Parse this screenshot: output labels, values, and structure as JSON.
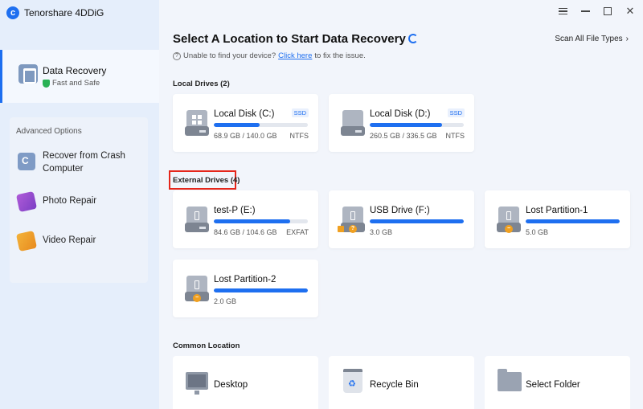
{
  "app": {
    "title": "Tenorshare 4DDiG",
    "logo_letter": "c"
  },
  "sidebar": {
    "data_recovery": {
      "label": "Data Recovery",
      "sub": "Fast and Safe"
    },
    "advanced": {
      "title": "Advanced Options",
      "items": [
        {
          "label": "Recover from Crash Computer",
          "icon": "computer-crash-icon"
        },
        {
          "label": "Photo Repair",
          "icon": "photo-repair-icon"
        },
        {
          "label": "Video Repair",
          "icon": "video-repair-icon"
        }
      ]
    }
  },
  "header": {
    "title": "Select A Location to Start Data Recovery",
    "scan_all": "Scan All File Types",
    "scan_all_arrow": "›",
    "hint_prefix": "Unable to find your device?",
    "hint_link": "Click here",
    "hint_suffix": "to fix the issue."
  },
  "local_drives": {
    "title": "Local Drives (2)",
    "items": [
      {
        "name": "Local Disk (C:)",
        "type": "SSD",
        "size": "68.9 GB / 140.0 GB",
        "fs": "NTFS",
        "used_fraction": 0.49
      },
      {
        "name": "Local Disk (D:)",
        "type": "SSD",
        "size": "260.5 GB / 336.5 GB",
        "fs": "NTFS",
        "used_fraction": 0.77
      }
    ]
  },
  "external_drives": {
    "title": "External Drives (4)",
    "items": [
      {
        "name": "test-P (E:)",
        "size": "84.6 GB / 104.6 GB",
        "fs": "EXFAT",
        "used_fraction": 0.81
      },
      {
        "name": "USB Drive (F:)",
        "size": "3.0 GB",
        "fs": "",
        "used_fraction": 1.0
      },
      {
        "name": "Lost Partition-1",
        "size": "5.0 GB",
        "fs": "",
        "used_fraction": 1.0
      },
      {
        "name": "Lost Partition-2",
        "size": "2.0 GB",
        "fs": "",
        "used_fraction": 1.0
      }
    ]
  },
  "common_location": {
    "title": "Common Location",
    "items": [
      {
        "label": "Desktop",
        "icon": "desktop-icon"
      },
      {
        "label": "Recycle Bin",
        "icon": "recycle-bin-icon"
      },
      {
        "label": "Select Folder",
        "icon": "folder-icon"
      }
    ]
  },
  "colors": {
    "accent": "#1e6ff0",
    "highlight_border": "#e5261b",
    "safe_green": "#29b155"
  },
  "window_controls": {
    "close_glyph": "✕"
  }
}
